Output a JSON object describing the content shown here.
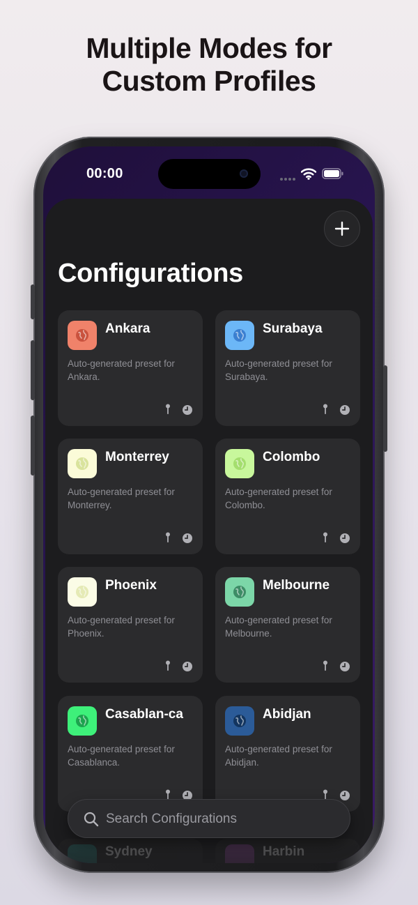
{
  "headline": {
    "line1": "Multiple Modes for",
    "line2": "Custom Profiles"
  },
  "status_bar": {
    "time": "00:00",
    "icons": [
      "signal-dots-icon",
      "wifi-icon",
      "battery-icon"
    ]
  },
  "header": {
    "title": "Configurations",
    "add_icon": "plus-icon"
  },
  "configurations": [
    {
      "name": "Ankara",
      "description": "Auto-generated preset for Ankara.",
      "icon_color": "#f0826a",
      "globe_color": "#c9523e"
    },
    {
      "name": "Surabaya",
      "description": "Auto-generated preset for Surabaya.",
      "icon_color": "#6cb7f7",
      "globe_color": "#3b7fd0"
    },
    {
      "name": "Monterrey",
      "description": "Auto-generated preset for Monterrey.",
      "icon_color": "#fbfbd8",
      "globe_color": "#d9e39c"
    },
    {
      "name": "Colombo",
      "description": "Auto-generated preset for Colombo.",
      "icon_color": "#c8f79c",
      "globe_color": "#a4de6e"
    },
    {
      "name": "Phoenix",
      "description": "Auto-generated preset for Phoenix.",
      "icon_color": "#fbfce6",
      "globe_color": "#e5eab5"
    },
    {
      "name": "Melbourne",
      "description": "Auto-generated preset for Melbourne.",
      "icon_color": "#7cd6a8",
      "globe_color": "#3d8c66"
    },
    {
      "name": "Casablanca",
      "name_display": "Casablan-ca",
      "description": "Auto-generated preset for Casablanca.",
      "icon_color": "#3ef07a",
      "globe_color": "#1ca34e"
    },
    {
      "name": "Abidjan",
      "description": "Auto-generated preset for Abidjan.",
      "icon_color": "#2b5b98",
      "globe_color": "#13355f"
    }
  ],
  "partial_configurations": [
    {
      "name": "Sydney",
      "icon_color": "#2f8c86"
    },
    {
      "name": "Harbin",
      "icon_color": "#9a4fa4"
    }
  ],
  "card_icons": {
    "pin": "pin-icon",
    "clock": "clock-icon",
    "globe": "globe-icon"
  },
  "search": {
    "placeholder": "Search Configurations",
    "value": "",
    "icon": "search-icon"
  },
  "colors": {
    "background": "#1c1c1e",
    "card": "#2b2b2d",
    "accent_bezel": "#1b1b1d"
  }
}
